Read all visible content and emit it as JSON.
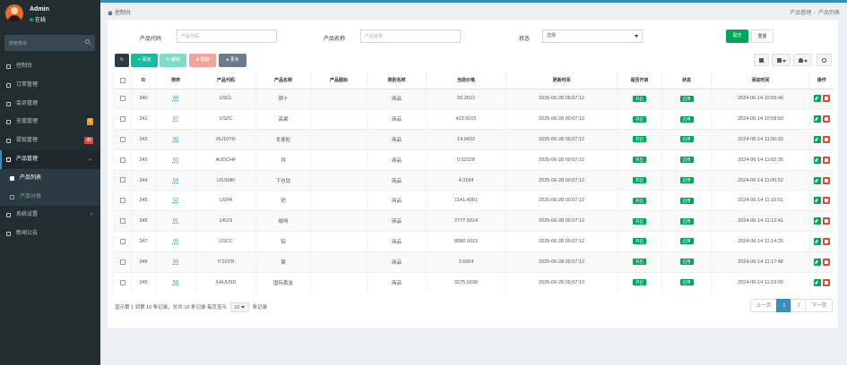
{
  "user": {
    "name": "Admin",
    "status": "在线"
  },
  "sidebar": {
    "search_placeholder": "搜索菜单",
    "items": [
      {
        "label": "控制台",
        "icon": "dashboard-icon"
      },
      {
        "label": "订单管理",
        "icon": "list-icon"
      },
      {
        "label": "会员管理",
        "icon": "users-icon"
      },
      {
        "label": "充值管理",
        "icon": "money-icon",
        "badge": "0",
        "badge_color": "#f39c12"
      },
      {
        "label": "提现管理",
        "icon": "gift-icon",
        "badge": "45",
        "badge_color": "#dd4b39"
      },
      {
        "label": "产品管理",
        "icon": "cube-icon",
        "arrow": "⌄",
        "active": true
      },
      {
        "label": "产品列表",
        "icon": "square-icon",
        "sub": true,
        "current": true
      },
      {
        "label": "产品分类",
        "icon": "square-icon",
        "sub": true
      },
      {
        "label": "系统设置",
        "icon": "gear-icon",
        "arrow": "‹"
      },
      {
        "label": "新闻公告",
        "icon": "news-icon"
      }
    ]
  },
  "breadcrumb": {
    "home": "控制台",
    "parent": "产品管理",
    "current": "产品列表"
  },
  "filters": {
    "code_label": "产品代码",
    "code_placeholder": "产品代码",
    "name_label": "产品名称",
    "name_placeholder": "产品名称",
    "status_label": "状态",
    "status_value": "选择",
    "submit": "提交",
    "reset": "重置"
  },
  "toolbar": {
    "add": "添加",
    "edit": "编辑",
    "delete": "删除",
    "more": "更多"
  },
  "table": {
    "columns": [
      "ID",
      "排序",
      "产品代码",
      "产品名称",
      "产品图标",
      "类别名称",
      "当前价格",
      "更新时间",
      "是否开启",
      "状态",
      "添加时间",
      "操作"
    ],
    "rows": [
      [
        "340",
        "68",
        "USCL",
        "铜十",
        "",
        "商品",
        "66.2612",
        "2025-06-28 00:07:12",
        "开启",
        "启用",
        "2024-06-14 10:56:46"
      ],
      [
        "341",
        "67",
        "USZC",
        "高粱",
        "",
        "商品",
        "423.5015",
        "2025-06-28 00:07:12",
        "开启",
        "启用",
        "2024-06-14 10:58:50"
      ],
      [
        "342",
        "66",
        "RU10YR",
        "冬麦粒",
        "",
        "商品",
        "14.9432",
        "2025-06-28 00:07:12",
        "开启",
        "启用",
        "2024-06-14 11:00:33"
      ],
      [
        "343",
        "65",
        "AUDCHF",
        "锌",
        "",
        "商品",
        "0.52228",
        "2025-06-28 00:07:12",
        "开启",
        "启用",
        "2024-06-14 11:02:35"
      ],
      [
        "344",
        "64",
        "USSMR",
        "下仓钛",
        "",
        "商品",
        "4.3184",
        "2025-06-28 00:07:12",
        "开启",
        "启用",
        "2024-06-14 11:05:52"
      ],
      [
        "345",
        "62",
        "USPA",
        "钯",
        "",
        "商品",
        "1141.4991",
        "2025-06-28 00:07:12",
        "开启",
        "启用",
        "2024-06-14 11:10:51"
      ],
      [
        "346",
        "61",
        "UKZS",
        "咖啡",
        "",
        "商品",
        "2777.5014",
        "2025-06-28 00:07:12",
        "开启",
        "启用",
        "2024-06-14 11:12:41"
      ],
      [
        "347",
        "60",
        "USCC",
        "铝",
        "",
        "商品",
        "8980.0013",
        "2025-06-28 00:07:12",
        "开启",
        "启用",
        "2024-06-14 11:14:25"
      ],
      [
        "348",
        "59",
        "IT10YR",
        "镍",
        "",
        "商品",
        "3.5004",
        "2025-06-28 00:07:12",
        "开启",
        "启用",
        "2024-06-14 11:17:48"
      ],
      [
        "349",
        "58",
        "XAUUSD",
        "国际黄金",
        "",
        "商品",
        "3275.9198",
        "2025-06-28 00:07:12",
        "开启",
        "启用",
        "2024-06-14 11:19:00"
      ]
    ]
  },
  "pagination": {
    "info_prefix": "显示第 1 到第 10 条记录，总共 18 条记录 每页显示",
    "page_size": "10",
    "info_suffix": "条记录",
    "prev": "上一页",
    "pages": [
      "1",
      "2"
    ],
    "next": "下一页"
  },
  "colors": {
    "sidebar": "#222d32",
    "accent": "#3c8dbc",
    "success": "#00a65a",
    "danger": "#dd4b39"
  }
}
